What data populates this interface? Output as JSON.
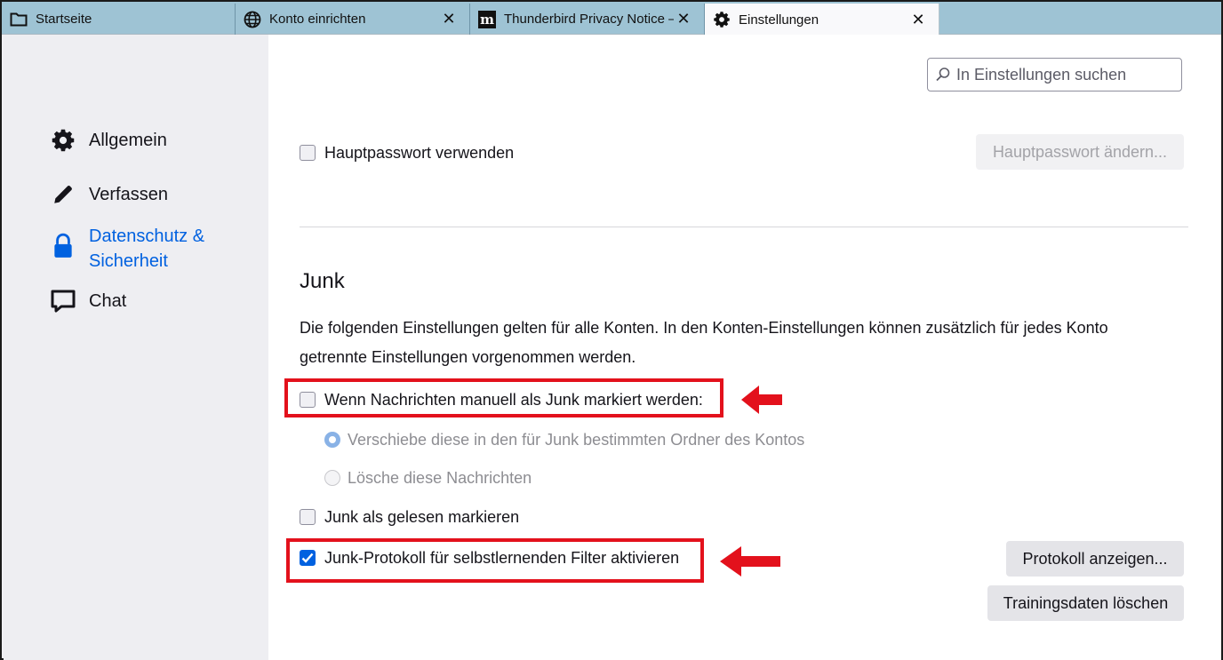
{
  "tabs": [
    {
      "label": "Startseite",
      "icon": "folder-icon"
    },
    {
      "label": "Konto einrichten",
      "icon": "globe-icon"
    },
    {
      "label": "Thunderbird Privacy Notice — ",
      "icon": "mozilla-m-icon"
    },
    {
      "label": "Einstellungen",
      "icon": "gear-icon"
    }
  ],
  "sidebar": {
    "items": [
      {
        "label": "Allgemein",
        "icon": "gear-icon"
      },
      {
        "label": "Verfassen",
        "icon": "pencil-icon"
      },
      {
        "label_line1": "Datenschutz &",
        "label_line2": "Sicherheit",
        "icon": "lock-icon",
        "active": true
      },
      {
        "label": "Chat",
        "icon": "chat-bubble-icon"
      }
    ]
  },
  "search": {
    "placeholder": "In Einstellungen suchen"
  },
  "master_password": {
    "checkbox_label": "Hauptpasswort verwenden",
    "checked": false,
    "change_button": "Hauptpasswort ändern..."
  },
  "junk": {
    "heading": "Junk",
    "description": "Die folgenden Einstellungen gelten für alle Konten. In den Konten-Einstellungen können zusätzlich für jedes Konto getrennte Einstellungen vorgenommen werden.",
    "manual_mark_label": "Wenn Nachrichten manuell als Junk markiert werden:",
    "manual_mark_checked": false,
    "radio_move": "Verschiebe diese in den für Junk bestimmten Ordner des Kontos",
    "radio_delete": "Lösche diese Nachrichten",
    "mark_read_label": "Junk als gelesen markieren",
    "mark_read_checked": false,
    "log_label": "Junk-Protokoll für selbstlernenden Filter aktivieren",
    "log_checked": true,
    "show_log_button": "Protokoll anzeigen...",
    "reset_training_button": "Trainingsdaten löschen"
  },
  "colors": {
    "accent": "#0061e0",
    "highlight": "#e3111c",
    "tabbar": "#9ec3d4"
  }
}
